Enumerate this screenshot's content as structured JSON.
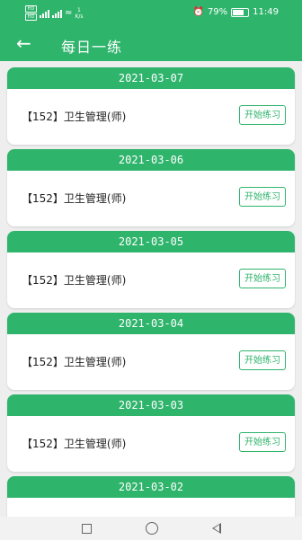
{
  "status_bar": {
    "sim1": "HD",
    "sim2": "HD",
    "net1": "4G",
    "net2": "4G",
    "speed": "1",
    "speed_unit": "K/s",
    "battery": "79%",
    "time": "11:49"
  },
  "app_bar": {
    "title": "每日一练"
  },
  "cards": [
    {
      "date": "2021-03-07",
      "name": "【152】卫生管理(师)",
      "button": "开始练习"
    },
    {
      "date": "2021-03-06",
      "name": "【152】卫生管理(师)",
      "button": "开始练习"
    },
    {
      "date": "2021-03-05",
      "name": "【152】卫生管理(师)",
      "button": "开始练习"
    },
    {
      "date": "2021-03-04",
      "name": "【152】卫生管理(师)",
      "button": "开始练习"
    },
    {
      "date": "2021-03-03",
      "name": "【152】卫生管理(师)",
      "button": "开始练习"
    },
    {
      "date": "2021-03-02"
    }
  ],
  "colors": {
    "accent": "#2fb46c",
    "background": "#eeeeee"
  }
}
